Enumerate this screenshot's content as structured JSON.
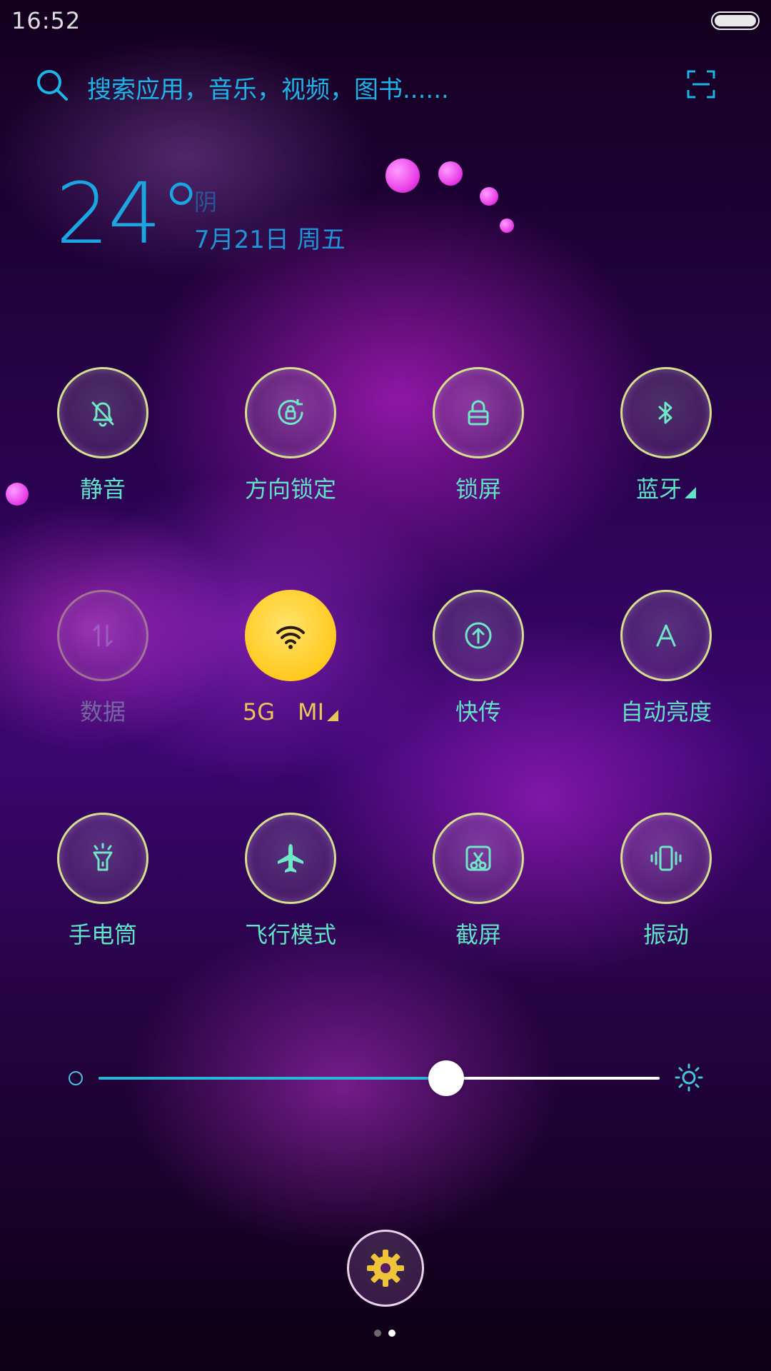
{
  "status_bar": {
    "time": "16:52"
  },
  "search": {
    "placeholder": "搜索应用，音乐，视频，图书......"
  },
  "weather": {
    "temperature": "24°",
    "condition": "阴",
    "date": "7月21日 周五"
  },
  "tiles": [
    {
      "label": "静音",
      "icon": "bell-off-icon",
      "state": "off"
    },
    {
      "label": "方向锁定",
      "icon": "rotation-lock-icon",
      "state": "off"
    },
    {
      "label": "锁屏",
      "icon": "lock-icon",
      "state": "off"
    },
    {
      "label": "蓝牙",
      "icon": "bluetooth-icon",
      "state": "off",
      "has_menu": true
    },
    {
      "label": "数据",
      "icon": "mobile-data-icon",
      "state": "disabled"
    },
    {
      "label": "5G　MI",
      "icon": "wifi-icon",
      "state": "on",
      "has_menu": true
    },
    {
      "label": "快传",
      "icon": "quick-share-icon",
      "state": "off"
    },
    {
      "label": "自动亮度",
      "icon": "auto-brightness-icon",
      "state": "off"
    },
    {
      "label": "手电筒",
      "icon": "flashlight-icon",
      "state": "off"
    },
    {
      "label": "飞行模式",
      "icon": "airplane-icon",
      "state": "off"
    },
    {
      "label": "截屏",
      "icon": "screenshot-icon",
      "state": "off"
    },
    {
      "label": "振动",
      "icon": "vibrate-icon",
      "state": "off"
    }
  ],
  "brightness": {
    "level": 0.62
  },
  "page_indicator": {
    "total": 2,
    "current": 2
  },
  "colors": {
    "accent": "#5fe3c4",
    "active_tile": "#ffc81a",
    "search_text": "#1db4e8",
    "slider_fill": "#2ab6d6"
  }
}
